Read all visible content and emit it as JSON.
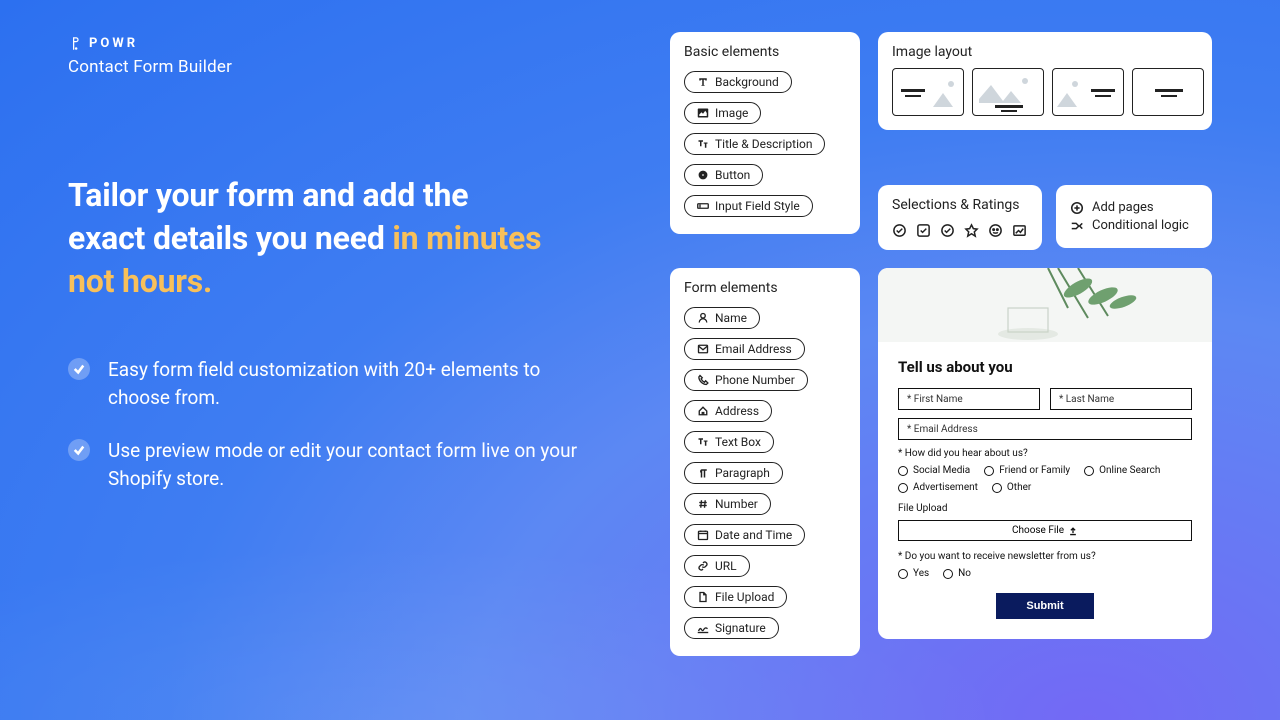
{
  "brand": "POWR",
  "product": "Contact Form Builder",
  "headline": {
    "line1": "Tailor your form and add the",
    "line2": "exact details you need ",
    "accent": "in minutes not hours."
  },
  "bullets": [
    "Easy form field customization with 20+ elements to choose from.",
    "Use preview mode or edit your contact form live on your Shopify store."
  ],
  "basic": {
    "title": "Basic elements",
    "items": [
      "Background",
      "Image",
      "Title & Description",
      "Button",
      "Input Field Style"
    ]
  },
  "form": {
    "title": "Form elements",
    "items": [
      "Name",
      "Email Address",
      "Phone Number",
      "Address",
      "Text Box",
      "Paragraph",
      "Number",
      "Date and Time",
      "URL",
      "File Upload",
      "Signature"
    ]
  },
  "layout": {
    "title": "Image layout"
  },
  "selections": {
    "title": "Selections & Ratings"
  },
  "options": {
    "add_pages": "Add pages",
    "conditional": "Conditional logic"
  },
  "preview": {
    "heading": "Tell us about you",
    "first_name": "* First Name",
    "last_name": "* Last Name",
    "email": "* Email Address",
    "q_source": "* How did you hear about us?",
    "sources": [
      "Social Media",
      "Friend or Family",
      "Online Search",
      "Advertisement",
      "Other"
    ],
    "file_label": "File Upload",
    "choose_file": "Choose File",
    "q_newsletter": "* Do you want to receive newsletter from us?",
    "newsletter_opts": [
      "Yes",
      "No"
    ],
    "submit": "Submit"
  }
}
